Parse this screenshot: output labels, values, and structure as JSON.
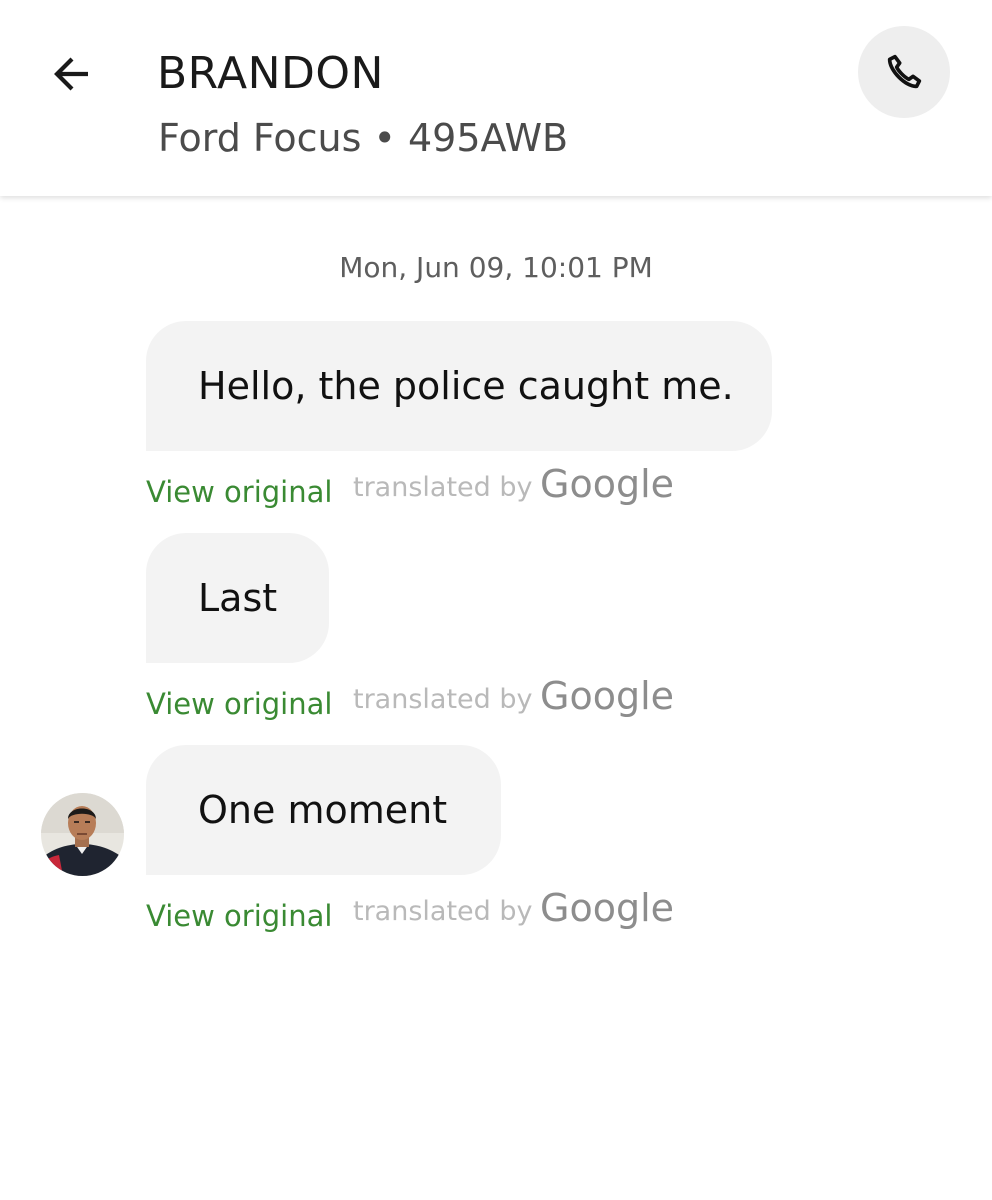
{
  "header": {
    "driver_name": "BRANDON",
    "vehicle_info": "Ford Focus • 495AWB",
    "back_icon": "arrow-left-icon",
    "call_icon": "phone-icon"
  },
  "conversation": {
    "timestamp": "Mon, Jun 09, 10:01 PM",
    "messages": [
      {
        "text": "Hello, the police caught me.",
        "view_original_label": "View original",
        "translated_by_label": "translated by",
        "provider_label": "Google"
      },
      {
        "text": "Last",
        "view_original_label": "View original",
        "translated_by_label": "translated by",
        "provider_label": "Google"
      },
      {
        "text": "One moment",
        "view_original_label": "View original",
        "translated_by_label": "translated by",
        "provider_label": "Google"
      }
    ]
  },
  "colors": {
    "accent_green": "#3a8a33",
    "bubble_background": "#f3f3f3",
    "call_button_background": "#eeeeee"
  }
}
